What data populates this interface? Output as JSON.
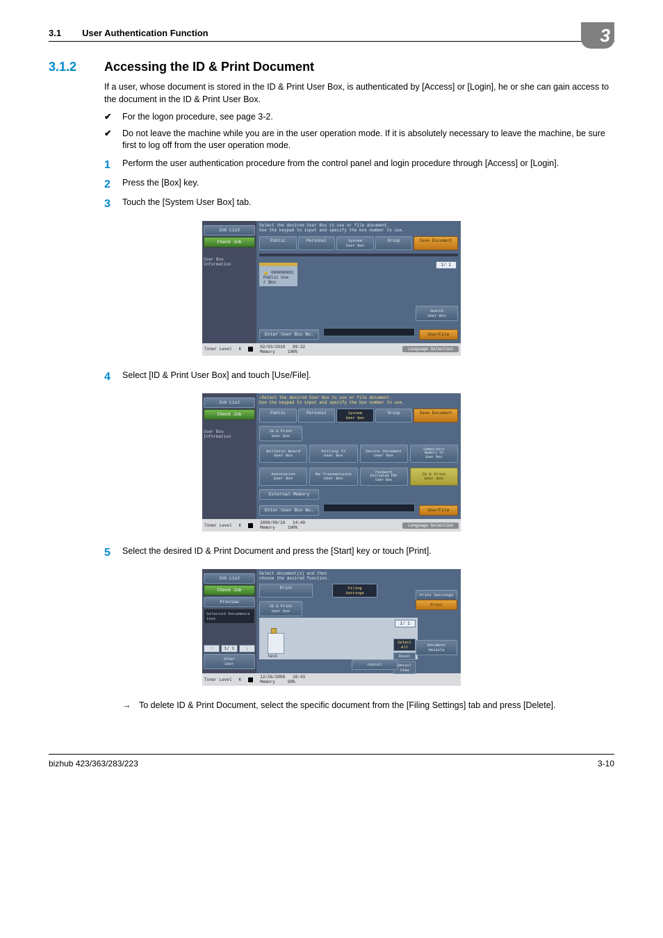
{
  "header": {
    "num": "3.1",
    "title": "User Authentication Function",
    "chapter": "3"
  },
  "section": {
    "num": "3.1.2",
    "title": "Accessing the ID & Print Document"
  },
  "intro": "If a user, whose document is stored in the ID & Print User Box, is authenticated by [Access] or [Login], he or she can gain access to the document in the ID & Print User Box.",
  "checks": [
    "For the logon procedure, see page 3-2.",
    "Do not leave the machine while you are in the user operation mode. If it is absolutely necessary to leave the machine, be sure first to log off from the user operation mode."
  ],
  "steps": [
    "Perform the user authentication procedure from the control panel and login procedure through [Access] or [Login].",
    "Press the [Box] key.",
    "Touch the [System User Box] tab.",
    "Select [ID & Print User Box] and touch [Use/File].",
    "Select the desired ID & Print Document and press the [Start] key or touch [Print]."
  ],
  "arrow": "To delete ID & Print Document, select the specific document from the [Filing Settings] tab and press [Delete].",
  "ss_common": {
    "job_list": "Job List",
    "check_job": "Check Job",
    "userbox_info": "User Box\nInformation",
    "toner": "Toner Level",
    "prompt": "Select the desired User Box to use or file document.\nUse the keypad to input and specify the box number to use.",
    "tabs": {
      "public": "Public",
      "personal": "Personal",
      "system": "System\nUser Box",
      "group": "Group"
    },
    "save": "Save Document",
    "enter": "Enter User Box No.",
    "usefile": "Use/File",
    "search": "Search\nUser Box",
    "lang": "Language Selection",
    "pager": "1/  1"
  },
  "ss1": {
    "folder": {
      "id": "000000001",
      "l1": "Public Use",
      "l2": "r Box"
    },
    "date": "02/03/2010",
    "time": "09:32",
    "mem": "Memory",
    "memv": "100%"
  },
  "ss2": {
    "idprint_tab": "ID & Print\nUser Box",
    "grid": [
      "Bulletin Board\nUser Box",
      "Polling TX\nUser Box",
      "Secure Document\nUser Box",
      "Compulsory\nMemory TX\nUser Box",
      "Annotation\nUser Box",
      "Re-Transmission\nUser Box",
      "Password\nEncrypted PDF\nUser Box",
      "ID & Print\nUser Box"
    ],
    "ext": "External Memory",
    "date": "2009/09/10",
    "time": "14:40",
    "mem": "Memory",
    "memv": "100%"
  },
  "ss3": {
    "prompt": "Select document(s) and then\nchoose the desired function.",
    "preview": "Preview",
    "seldocs": "Selected Documents",
    "test": "test",
    "print_tab": "Print",
    "filing_tab": "Filing\nSettings",
    "idprint_tab": "ID & Print\nUser Box",
    "print_settings": "Print Settings",
    "print": "Print",
    "select_all": "Select\nAll",
    "reset": "Reset",
    "detail": "Detail\nView",
    "doc_details": "Document\nDetails",
    "cancel": "Cancel",
    "date": "12/26/2008",
    "time": "10:43",
    "mem": "Memory",
    "memv": "99%",
    "thumb_label": "test",
    "up": "↑",
    "down": "↓",
    "pager": "1/  1",
    "other": "Other\nUser"
  },
  "footer": {
    "left": "bizhub 423/363/283/223",
    "right": "3-10"
  }
}
